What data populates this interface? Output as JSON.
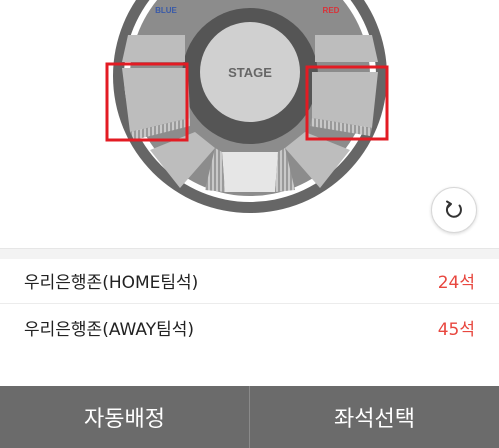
{
  "map": {
    "stage_label": "STAGE",
    "blue_label": "BLUE",
    "red_label": "RED",
    "colors": {
      "blue": "#3a5aa8",
      "red": "#d8333a",
      "highlight": "#e31b23"
    }
  },
  "refresh": {
    "icon": "refresh-icon"
  },
  "zones": [
    {
      "name": "우리은행존(HOME팀석)",
      "count": "24석"
    },
    {
      "name": "우리은행존(AWAY팀석)",
      "count": "45석"
    }
  ],
  "bottom": {
    "auto_assign": "자동배정",
    "select_seat": "좌석선택"
  }
}
